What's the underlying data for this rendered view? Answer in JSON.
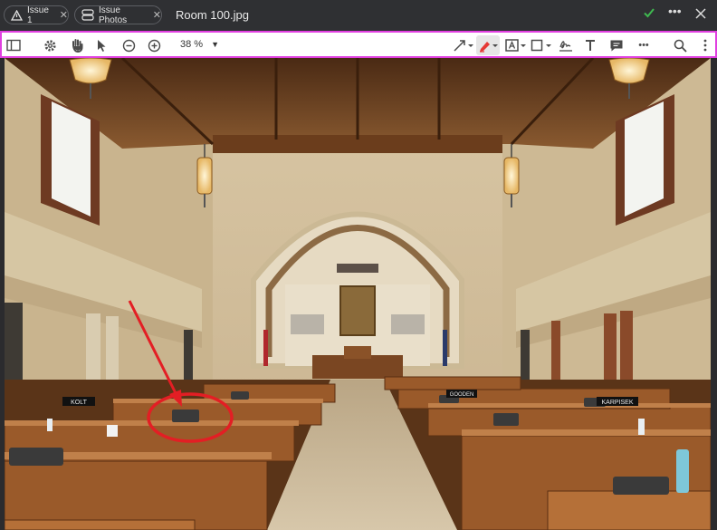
{
  "tabs": [
    {
      "label": "Issue 1",
      "icon": "issue-icon"
    },
    {
      "label": "Issue Photos",
      "icon": "photos-icon"
    }
  ],
  "document": {
    "title": "Room 100.jpg"
  },
  "window_actions": {
    "confirm_icon": "check-icon",
    "more_icon": "more-horizontal-icon",
    "close_icon": "close-icon"
  },
  "toolbar": {
    "zoom_level": "38 %",
    "left_tools": [
      "sidebar-toggle-icon",
      "settings-icon",
      "pan-hand-icon",
      "select-arrow-icon",
      "zoom-out-icon",
      "zoom-in-icon"
    ],
    "right_tools": [
      "line-arrow-icon",
      "pen-icon",
      "text-box-icon",
      "rectangle-icon",
      "signature-icon",
      "text-icon",
      "comment-icon",
      "more-horizontal-icon",
      "search-icon",
      "more-vertical-icon"
    ],
    "active_tool_color": "#e53935",
    "highlight_color": "#e040e0"
  },
  "photo": {
    "desk_nameplates": [
      "KOLT",
      "KARPISEK",
      "GOODEN"
    ],
    "markup_color": "#e31e24",
    "markups": [
      "arrow",
      "ellipse"
    ]
  }
}
